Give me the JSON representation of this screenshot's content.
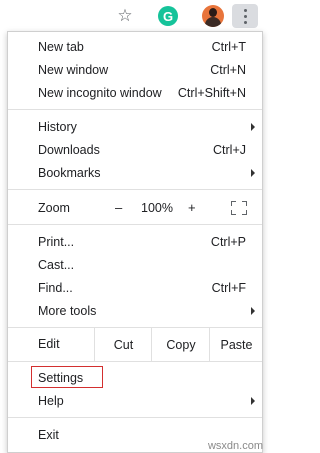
{
  "toolbar": {
    "icons": [
      "star-icon",
      "grammarly-icon",
      "profile-avatar",
      "kebab-menu-icon"
    ],
    "grammarly_letter": "G",
    "grammarly_color": "#15c39a"
  },
  "menu": {
    "new_tab": {
      "label": "New tab",
      "shortcut": "Ctrl+T"
    },
    "new_window": {
      "label": "New window",
      "shortcut": "Ctrl+N"
    },
    "new_incognito": {
      "label": "New incognito window",
      "shortcut": "Ctrl+Shift+N"
    },
    "history": {
      "label": "History"
    },
    "downloads": {
      "label": "Downloads",
      "shortcut": "Ctrl+J"
    },
    "bookmarks": {
      "label": "Bookmarks"
    },
    "zoom": {
      "label": "Zoom",
      "minus": "–",
      "value": "100%",
      "plus": "+"
    },
    "print": {
      "label": "Print...",
      "shortcut": "Ctrl+P"
    },
    "cast": {
      "label": "Cast..."
    },
    "find": {
      "label": "Find...",
      "shortcut": "Ctrl+F"
    },
    "more_tools": {
      "label": "More tools"
    },
    "edit": {
      "label": "Edit",
      "cut": "Cut",
      "copy": "Copy",
      "paste": "Paste"
    },
    "settings": {
      "label": "Settings"
    },
    "help": {
      "label": "Help"
    },
    "exit": {
      "label": "Exit"
    }
  },
  "highlight_color": "#d32f2f",
  "watermark": "wsxdn.com"
}
